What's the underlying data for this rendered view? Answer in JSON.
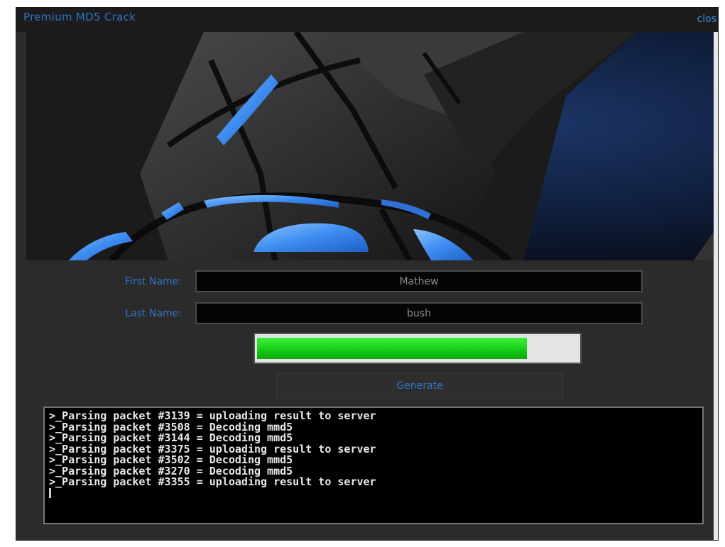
{
  "window": {
    "title": "Premium MD5  Crack",
    "close_label": "clos"
  },
  "form": {
    "first_name_label": "First Name:",
    "first_name_value": "Mathew",
    "last_name_label": "Last Name:",
    "last_name_value": "bush"
  },
  "progress": {
    "value_fraction": 0.84,
    "color": "#22dd22"
  },
  "generate_button": {
    "label": "Generate"
  },
  "console": {
    "lines": [
      ">_Parsing packet #3139 = uploading result to server",
      ">_Parsing packet #3508 = Decoding mmd5",
      ">_Parsing packet #3144 = Decoding mmd5",
      ">_Parsing packet #3375 = uploading result to server",
      ">_Parsing packet #3502 = Decoding mmd5",
      ">_Parsing packet #3270 = Decoding mmd5",
      ">_Parsing packet #3355 = uploading result to server"
    ]
  },
  "colors": {
    "accent_text": "#2f74c9",
    "panel_bg": "#2b2b2b"
  },
  "banner": {
    "icon": "abstract-3d-sphere-graphic"
  }
}
